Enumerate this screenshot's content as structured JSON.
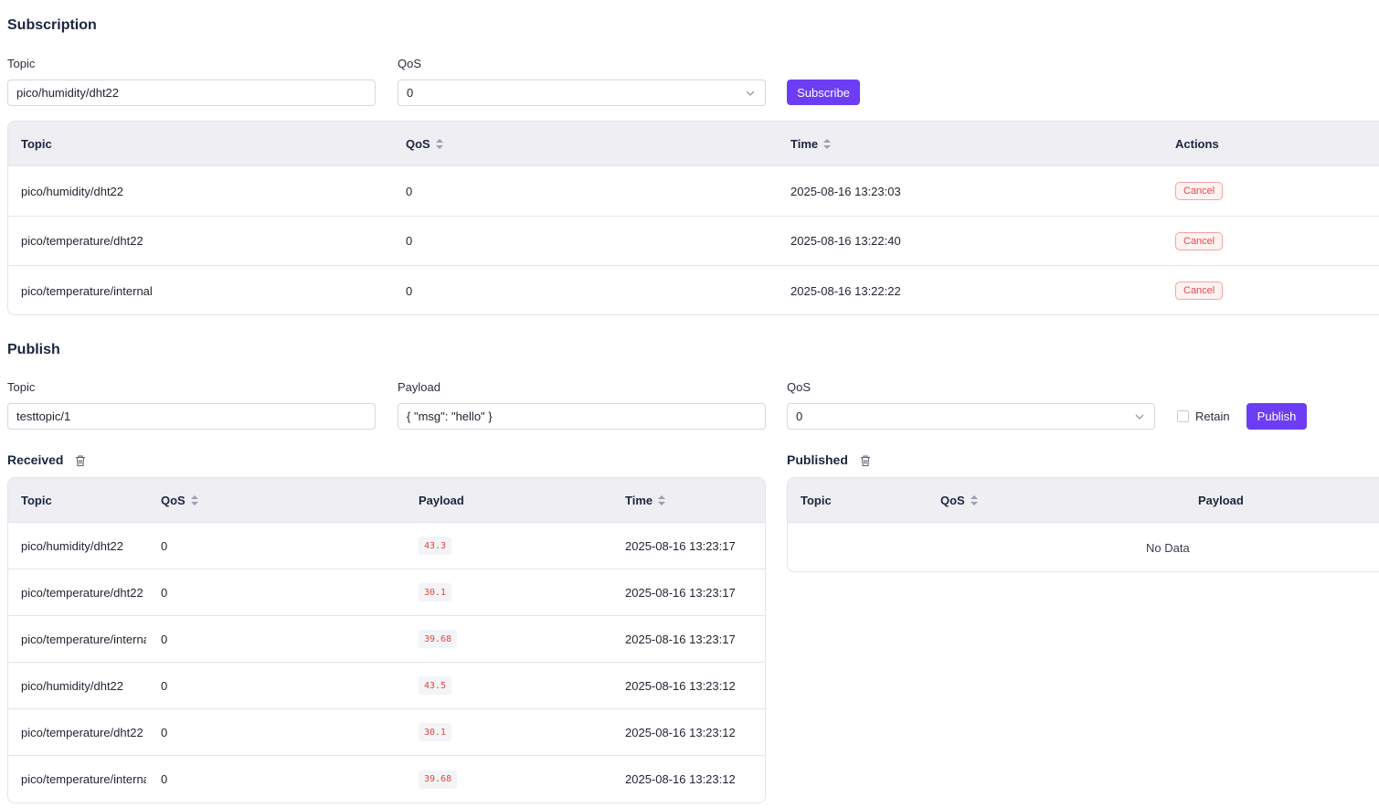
{
  "subscription": {
    "title": "Subscription",
    "topic_label": "Topic",
    "topic_value": "pico/humidity/dht22",
    "qos_label": "QoS",
    "qos_value": "0",
    "subscribe_label": "Subscribe",
    "columns": {
      "topic": "Topic",
      "qos": "QoS",
      "time": "Time",
      "actions": "Actions"
    },
    "rows": [
      {
        "topic": "pico/humidity/dht22",
        "qos": "0",
        "time": "2025-08-16 13:23:03",
        "action": "Cancel"
      },
      {
        "topic": "pico/temperature/dht22",
        "qos": "0",
        "time": "2025-08-16 13:22:40",
        "action": "Cancel"
      },
      {
        "topic": "pico/temperature/internal",
        "qos": "0",
        "time": "2025-08-16 13:22:22",
        "action": "Cancel"
      }
    ]
  },
  "publish": {
    "title": "Publish",
    "topic_label": "Topic",
    "topic_value": "testtopic/1",
    "payload_label": "Payload",
    "payload_value": "{ \"msg\": \"hello\" }",
    "qos_label": "QoS",
    "qos_value": "0",
    "retain_label": "Retain",
    "publish_label": "Publish"
  },
  "received": {
    "title": "Received",
    "columns": {
      "topic": "Topic",
      "qos": "QoS",
      "payload": "Payload",
      "time": "Time"
    },
    "rows": [
      {
        "topic": "pico/humidity/dht22",
        "qos": "0",
        "payload": "43.3",
        "time": "2025-08-16 13:23:17"
      },
      {
        "topic": "pico/temperature/dht22",
        "qos": "0",
        "payload": "30.1",
        "time": "2025-08-16 13:23:17"
      },
      {
        "topic": "pico/temperature/internal",
        "qos": "0",
        "payload": "39.68",
        "time": "2025-08-16 13:23:17"
      },
      {
        "topic": "pico/humidity/dht22",
        "qos": "0",
        "payload": "43.5",
        "time": "2025-08-16 13:23:12"
      },
      {
        "topic": "pico/temperature/dht22",
        "qos": "0",
        "payload": "30.1",
        "time": "2025-08-16 13:23:12"
      },
      {
        "topic": "pico/temperature/internal",
        "qos": "0",
        "payload": "39.68",
        "time": "2025-08-16 13:23:12"
      }
    ]
  },
  "published": {
    "title": "Published",
    "columns": {
      "topic": "Topic",
      "qos": "QoS",
      "payload": "Payload"
    },
    "empty_text": "No Data"
  },
  "colors": {
    "accent": "#6c3df4",
    "danger": "#e24a4a",
    "header_bg": "#eeeef3"
  }
}
